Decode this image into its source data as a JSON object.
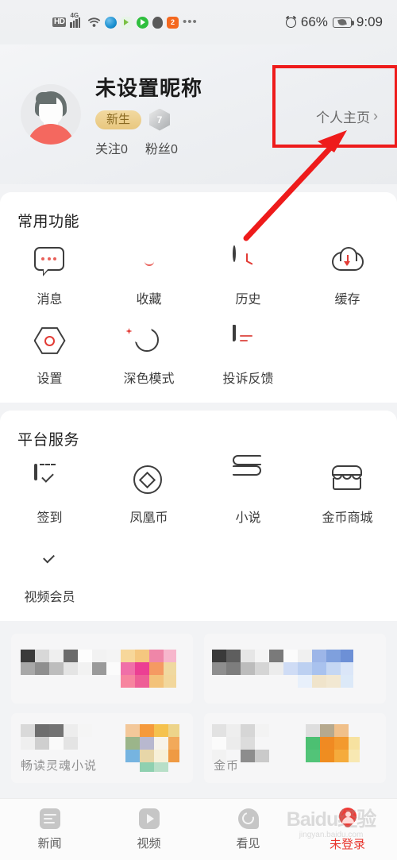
{
  "status_bar": {
    "hd_label": "HD",
    "network": "4G",
    "icons": [
      "hd-icon",
      "signal-icon",
      "wifi-icon",
      "browser-globe-icon",
      "app-icon",
      "play-icon",
      "qq-icon",
      "app-orange-icon",
      "more-dots-icon"
    ],
    "alarm_icon": "alarm-clock-icon",
    "battery_percent": "66%",
    "battery_icon": "battery-saver-icon",
    "time": "9:09"
  },
  "profile": {
    "nickname": "未设置昵称",
    "badge_label": "新生",
    "level": "7",
    "following_label": "关注",
    "following_count": "0",
    "followers_label": "粉丝",
    "followers_count": "0",
    "home_link": "个人主页",
    "chevron": "›",
    "avatar_icon": "default-avatar-icon"
  },
  "annotation": {
    "box_color": "#ee1b1b",
    "arrow_color": "#ee1b1b"
  },
  "sections": [
    {
      "title": "常用功能",
      "items": [
        {
          "label": "消息",
          "icon": "message-bubble-icon"
        },
        {
          "label": "收藏",
          "icon": "star-icon"
        },
        {
          "label": "历史",
          "icon": "clock-history-icon"
        },
        {
          "label": "缓存",
          "icon": "cloud-download-icon"
        },
        {
          "label": "设置",
          "icon": "settings-hexagon-icon"
        },
        {
          "label": "深色模式",
          "icon": "moon-icon"
        },
        {
          "label": "投诉反馈",
          "icon": "feedback-document-icon"
        }
      ]
    },
    {
      "title": "平台服务",
      "items": [
        {
          "label": "签到",
          "icon": "calendar-check-icon"
        },
        {
          "label": "凤凰币",
          "icon": "coin-icon"
        },
        {
          "label": "小说",
          "icon": "book-icon"
        },
        {
          "label": "金币商城",
          "icon": "shop-icon"
        },
        {
          "label": "视频会员",
          "icon": "gem-vip-icon"
        }
      ]
    }
  ],
  "promos": [
    {
      "text": "",
      "mosaic": "pink"
    },
    {
      "text": "",
      "mosaic": "blue"
    },
    {
      "text": "畅读灵魂小说",
      "mosaic": "orange"
    },
    {
      "text": "金币",
      "mosaic": "green-orange"
    }
  ],
  "tabbar": {
    "tabs": [
      {
        "label": "新闻",
        "icon": "news-icon",
        "active": false
      },
      {
        "label": "视频",
        "icon": "video-play-icon",
        "active": false
      },
      {
        "label": "看见",
        "icon": "discover-icon",
        "active": false
      },
      {
        "label": "未登录",
        "icon": "user-pin-icon",
        "active": true
      }
    ],
    "active_color": "#e8362e"
  },
  "watermark": {
    "line1": "Baidu经验",
    "line2": "jingyan.baidu.com"
  }
}
